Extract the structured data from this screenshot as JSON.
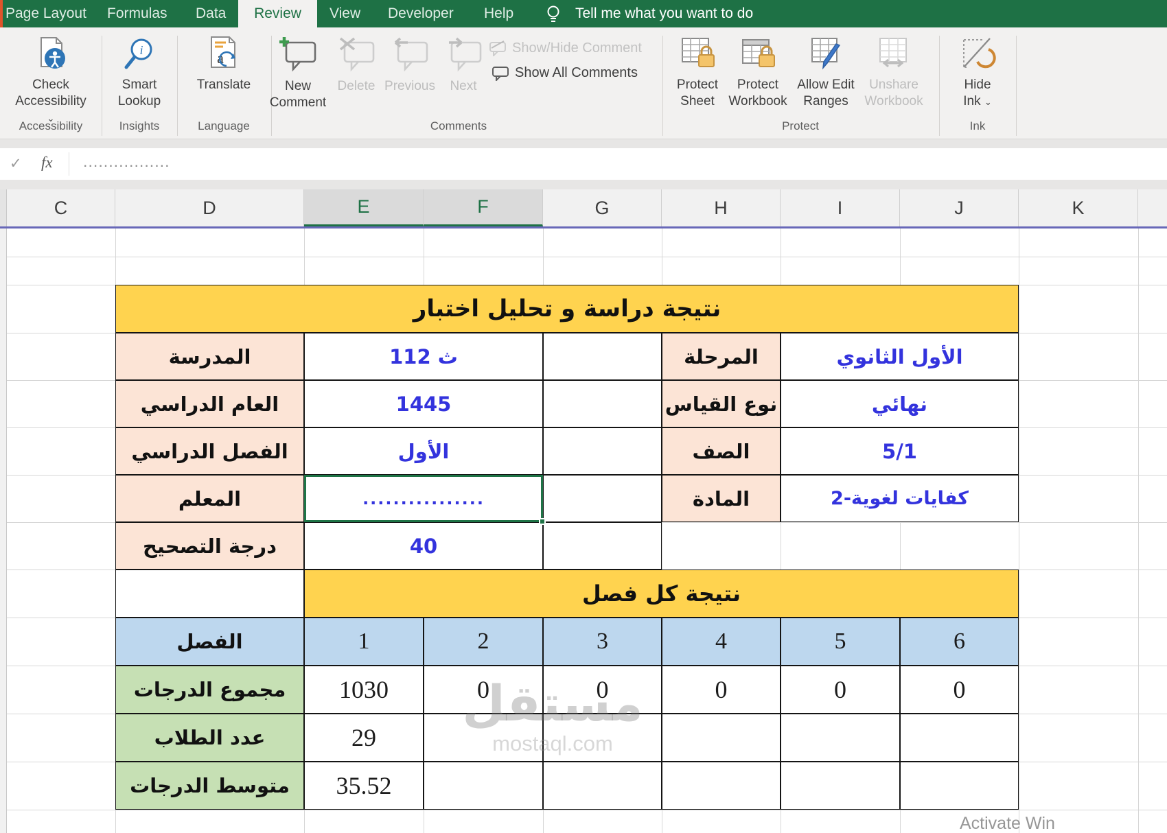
{
  "ribbon": {
    "tabs": [
      "Page Layout",
      "Formulas",
      "Data",
      "Review",
      "View",
      "Developer",
      "Help"
    ],
    "active_tab": "Review",
    "tell_me": "Tell me what you want to do",
    "chevron": "⌄",
    "groups": {
      "accessibility": "Accessibility",
      "insights": "Insights",
      "language": "Language",
      "comments": "Comments",
      "protect": "Protect",
      "ink": "Ink"
    },
    "buttons": {
      "check_accessibility": {
        "l1": "Check",
        "l2": "Accessibility"
      },
      "smart_lookup": {
        "l1": "Smart",
        "l2": "Lookup"
      },
      "translate": {
        "l1": "Translate"
      },
      "new_comment": {
        "l1": "New",
        "l2": "Comment"
      },
      "delete": {
        "l1": "Delete"
      },
      "previous": {
        "l1": "Previous"
      },
      "next": {
        "l1": "Next"
      },
      "show_hide_comment": {
        "label": "Show/Hide Comment"
      },
      "show_all_comments": {
        "label": "Show All Comments"
      },
      "protect_sheet": {
        "l1": "Protect",
        "l2": "Sheet"
      },
      "protect_workbook": {
        "l1": "Protect",
        "l2": "Workbook"
      },
      "allow_edit_ranges": {
        "l1": "Allow Edit",
        "l2": "Ranges"
      },
      "unshare_workbook": {
        "l1": "Unshare",
        "l2": "Workbook"
      },
      "hide_ink": {
        "l1": "Hide",
        "l2": "Ink"
      }
    }
  },
  "formula_bar": {
    "check": "✓",
    "fx": "fx",
    "content": "................."
  },
  "grid": {
    "columns": [
      "C",
      "D",
      "E",
      "F",
      "G",
      "H",
      "I",
      "J",
      "K"
    ],
    "selected_columns": "E,F"
  },
  "sheet": {
    "title": "نتيجة دراسة و تحليل اختبار",
    "left_fields": [
      {
        "label": "المدرسة",
        "value": "ث 112"
      },
      {
        "label": "العام الدراسي",
        "value": "1445"
      },
      {
        "label": "الفصل الدراسي",
        "value": "الأول"
      },
      {
        "label": "المعلم",
        "value": "................"
      },
      {
        "label": "درجة التصحيح",
        "value": "40"
      }
    ],
    "right_fields": [
      {
        "label": "المرحلة",
        "value": "الأول الثانوي"
      },
      {
        "label": "نوع القياس",
        "value": "نهائي"
      },
      {
        "label": "الصف",
        "value": "5/1"
      },
      {
        "label": "المادة",
        "value": "كفايات لغوية-2"
      }
    ],
    "section_title": "نتيجة كل فصل",
    "chapter_header": "الفصل",
    "chapters": [
      "1",
      "2",
      "3",
      "4",
      "5",
      "6"
    ],
    "stat_rows": [
      {
        "label": "مجموع الدرجات",
        "values": [
          "1030",
          "0",
          "0",
          "0",
          "0",
          "0"
        ]
      },
      {
        "label": "عدد الطلاب",
        "values": [
          "29",
          "",
          "",
          "",
          "",
          ""
        ]
      },
      {
        "label": "متوسط الدرجات",
        "values": [
          "35.52",
          "",
          "",
          "",
          "",
          ""
        ]
      }
    ]
  },
  "watermark": {
    "arabic": "مستقل",
    "latin": "mostaql.com"
  },
  "activate_text": "Activate Win",
  "colors": {
    "excel_green": "#1E7145",
    "title_yellow": "#FFD34F",
    "label_pink": "#FCE4D6",
    "header_blue": "#BDD7EE",
    "label_green": "#C6E0B4",
    "value_blue": "#3333DD",
    "selection_green": "#1E7346"
  }
}
